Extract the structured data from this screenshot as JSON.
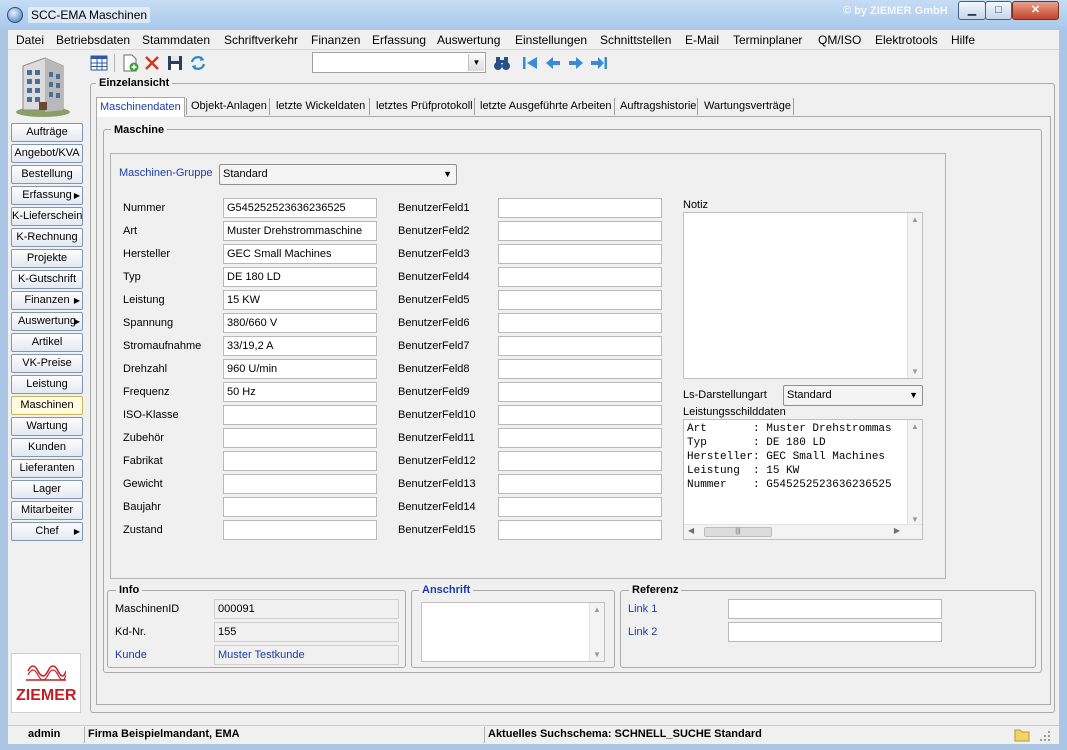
{
  "window": {
    "title": "SCC-EMA Maschinen",
    "copyright": "© by ZIEMER GmbH",
    "controls": {
      "minimize": "▁",
      "maximize": "□",
      "close": "✕"
    }
  },
  "menu": [
    "Datei",
    "Betriebsdaten",
    "Stammdaten",
    "Schriftverkehr",
    "Finanzen",
    "Erfassung",
    "Auswertung",
    "Einstellungen",
    "Schnittstellen",
    "E-Mail",
    "Terminplaner",
    "QM/ISO",
    "Elektrotools",
    "Hilfe"
  ],
  "nav": [
    {
      "label": "Aufträge",
      "arrow": ""
    },
    {
      "label": "Angebot/KVA",
      "arrow": ""
    },
    {
      "label": "Bestellung",
      "arrow": ""
    },
    {
      "label": "Erfassung",
      "arrow": "▶"
    },
    {
      "label": "K-Lieferschein",
      "arrow": ""
    },
    {
      "label": "K-Rechnung",
      "arrow": ""
    },
    {
      "label": "Projekte",
      "arrow": ""
    },
    {
      "label": "K-Gutschrift",
      "arrow": ""
    },
    {
      "label": "Finanzen",
      "arrow": "▶"
    },
    {
      "label": "Auswertung",
      "arrow": "▶"
    },
    {
      "label": "Artikel",
      "arrow": ""
    },
    {
      "label": "VK-Preise",
      "arrow": ""
    },
    {
      "label": "Leistung",
      "arrow": ""
    },
    {
      "label": "Maschinen",
      "arrow": "",
      "active": true
    },
    {
      "label": "Wartung",
      "arrow": ""
    },
    {
      "label": "Kunden",
      "arrow": ""
    },
    {
      "label": "Lieferanten",
      "arrow": ""
    },
    {
      "label": "Lager",
      "arrow": ""
    },
    {
      "label": "Mitarbeiter",
      "arrow": ""
    },
    {
      "label": "Chef",
      "arrow": "▶"
    }
  ],
  "logo": {
    "text": "ZIEMER",
    "color": "#c41e24"
  },
  "toolbar": {
    "icons": [
      "grid-view-icon",
      "new-document-icon",
      "delete-icon",
      "save-icon",
      "refresh-icon"
    ],
    "search_value": "",
    "nav_icons": [
      "binoculars-icon",
      "first-record-icon",
      "previous-record-icon",
      "next-record-icon",
      "last-record-icon"
    ]
  },
  "section_title": "Einzelansicht",
  "tabs": [
    "Maschinendaten",
    "Objekt-Anlagen",
    "letzte Wickeldaten",
    "letztes Prüfprotokoll",
    "letzte Ausgeführte Arbeiten",
    "Auftragshistorie",
    "Wartungsverträge"
  ],
  "maschine": {
    "legend": "Maschine",
    "gruppe_label": "Maschinen-Gruppe",
    "gruppe_value": "Standard",
    "fields": [
      {
        "label": "Nummer",
        "value": "G545252523636236525"
      },
      {
        "label": "Art",
        "value": "Muster Drehstrommaschine"
      },
      {
        "label": "Hersteller",
        "value": "GEC Small Machines"
      },
      {
        "label": "Typ",
        "value": "DE 180 LD"
      },
      {
        "label": "Leistung",
        "value": "15 KW"
      },
      {
        "label": "Spannung",
        "value": "380/660 V"
      },
      {
        "label": "Stromaufnahme",
        "value": "33/19,2 A"
      },
      {
        "label": "Drehzahl",
        "value": "960 U/min"
      },
      {
        "label": "Frequenz",
        "value": "50 Hz"
      },
      {
        "label": "ISO-Klasse",
        "value": ""
      },
      {
        "label": "Zubehör",
        "value": ""
      },
      {
        "label": "Fabrikat",
        "value": ""
      },
      {
        "label": "Gewicht",
        "value": ""
      },
      {
        "label": "Baujahr",
        "value": ""
      },
      {
        "label": "Zustand",
        "value": ""
      }
    ],
    "user_fields": [
      {
        "label": "BenutzerFeld1",
        "value": ""
      },
      {
        "label": "BenutzerFeld2",
        "value": ""
      },
      {
        "label": "BenutzerFeld3",
        "value": ""
      },
      {
        "label": "BenutzerFeld4",
        "value": ""
      },
      {
        "label": "BenutzerFeld5",
        "value": ""
      },
      {
        "label": "BenutzerFeld6",
        "value": ""
      },
      {
        "label": "BenutzerFeld7",
        "value": ""
      },
      {
        "label": "BenutzerFeld8",
        "value": ""
      },
      {
        "label": "BenutzerFeld9",
        "value": ""
      },
      {
        "label": "BenutzerFeld10",
        "value": ""
      },
      {
        "label": "BenutzerFeld11",
        "value": ""
      },
      {
        "label": "BenutzerFeld12",
        "value": ""
      },
      {
        "label": "BenutzerFeld13",
        "value": ""
      },
      {
        "label": "BenutzerFeld14",
        "value": ""
      },
      {
        "label": "BenutzerFeld15",
        "value": ""
      }
    ],
    "notiz_label": "Notiz",
    "notiz_value": "",
    "ls_label": "Ls-Darstellungart",
    "ls_value": "Standard",
    "leistung_label": "Leistungsschilddaten",
    "leistung_lines": [
      "Art       : Muster Drehstrommas",
      "Typ       : DE 180 LD",
      "Hersteller: GEC Small Machines",
      "Leistung  : 15 KW",
      "Nummer    : G545252523636236525"
    ]
  },
  "info": {
    "legend": "Info",
    "rows": [
      {
        "label": "MaschinenID",
        "value": "000091"
      },
      {
        "label": "Kd-Nr.",
        "value": "155"
      },
      {
        "label": "Kunde",
        "value": "Muster Testkunde"
      }
    ]
  },
  "anschrift": {
    "legend": "Anschrift",
    "value": ""
  },
  "referenz": {
    "legend": "Referenz",
    "links": [
      {
        "label": "Link 1",
        "value": ""
      },
      {
        "label": "Link 2",
        "value": ""
      }
    ]
  },
  "status": {
    "user": "admin",
    "firma": "Firma Beispielmandant, EMA",
    "schema": "Aktuelles Suchschema: SCHNELL_SUCHE Standard"
  }
}
